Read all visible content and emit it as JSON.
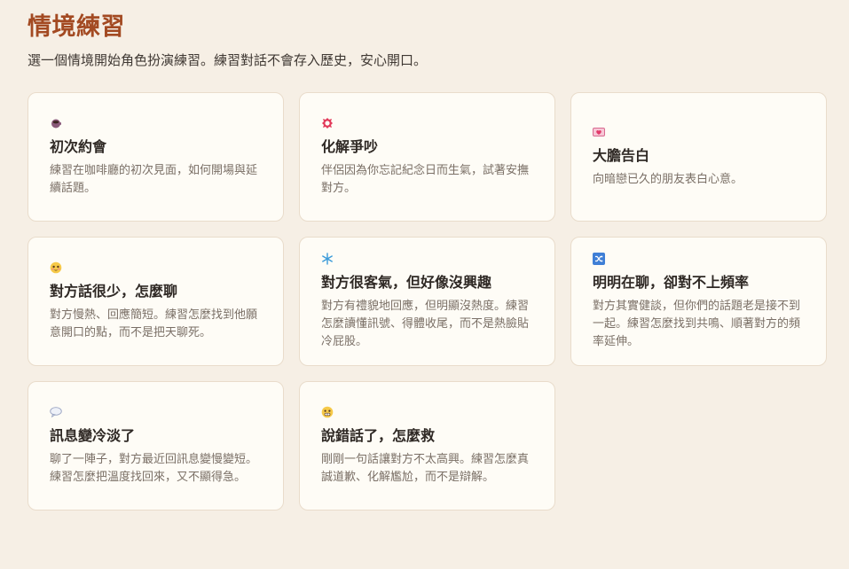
{
  "header": {
    "title": "情境練習",
    "subtitle": "選一個情境開始角色扮演練習。練習對話不會存入歷史，安心開口。"
  },
  "scenarios": [
    {
      "title": "初次約會",
      "description": "練習在咖啡廳的初次見面，如何開場與延續話題。",
      "icon": "coffee-icon"
    },
    {
      "title": "化解爭吵",
      "description": "伴侶因為你忘記紀念日而生氣，試著安撫對方。",
      "icon": "anger-icon"
    },
    {
      "title": "大膽告白",
      "description": "向暗戀已久的朋友表白心意。",
      "icon": "love-letter-icon"
    },
    {
      "title": "對方話很少，怎麼聊",
      "description": "對方慢熱、回應簡短。練習怎麼找到他願意開口的點，而不是把天聊死。",
      "icon": "shy-face-icon"
    },
    {
      "title": "對方很客氣，但好像沒興趣",
      "description": "對方有禮貌地回應，但明顯沒熱度。練習怎麼讀懂訊號、得體收尾，而不是熱臉貼冷屁股。",
      "icon": "snowflake-icon"
    },
    {
      "title": "明明在聊，卻對不上頻率",
      "description": "對方其實健談，但你們的話題老是接不到一起。練習怎麼找到共鳴、順著對方的頻率延伸。",
      "icon": "shuffle-icon"
    },
    {
      "title": "訊息變冷淡了",
      "description": "聊了一陣子，對方最近回訊息變慢變短。練習怎麼把溫度找回來，又不顯得急。",
      "icon": "speech-bubble-icon"
    },
    {
      "title": "說錯話了，怎麼救",
      "description": "剛剛一句話讓對方不太高興。練習怎麼真誠道歉、化解尷尬，而不是辯解。",
      "icon": "grimace-face-icon"
    }
  ]
}
